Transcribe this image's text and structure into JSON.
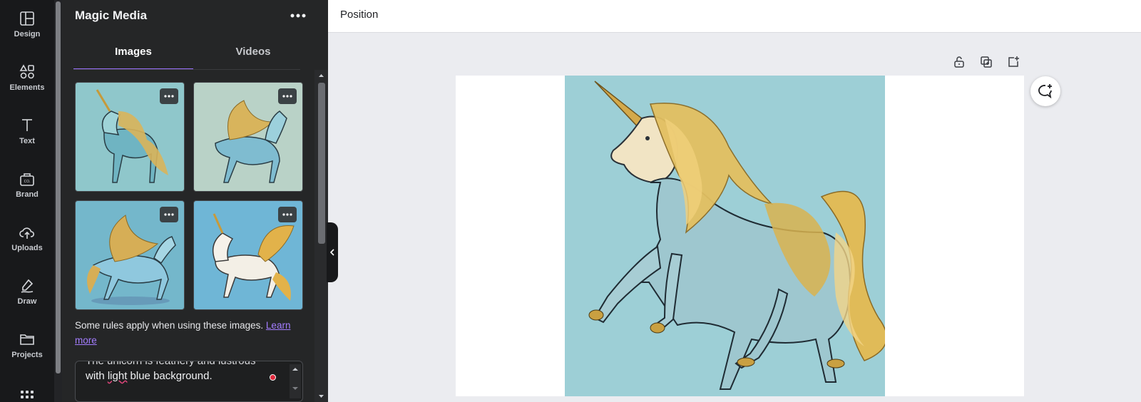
{
  "rail": {
    "items": [
      {
        "label": "Design",
        "icon": "layout-icon"
      },
      {
        "label": "Elements",
        "icon": "shapes-icon"
      },
      {
        "label": "Text",
        "icon": "text-icon"
      },
      {
        "label": "Brand",
        "icon": "brand-icon"
      },
      {
        "label": "Uploads",
        "icon": "cloud-upload-icon"
      },
      {
        "label": "Draw",
        "icon": "pen-icon"
      },
      {
        "label": "Projects",
        "icon": "folder-icon"
      }
    ],
    "more_icon": "apps-grid-icon"
  },
  "panel": {
    "title": "Magic Media",
    "tabs": [
      {
        "label": "Images",
        "active": true
      },
      {
        "label": "Videos",
        "active": false
      }
    ],
    "rules_text": "Some rules apply when using these images.",
    "learn_more": "Learn more",
    "prompt": {
      "partial_line": "The unicorn is feathery and lustrous",
      "line_before": "with ",
      "misspelled": "light",
      "line_after": " blue background."
    }
  },
  "topbar": {
    "position_label": "Position"
  },
  "colors": {
    "accent": "#9c72ff",
    "rail_bg": "#18191b",
    "panel_bg": "#252627",
    "artwork_bg": "#9dcfd6"
  }
}
